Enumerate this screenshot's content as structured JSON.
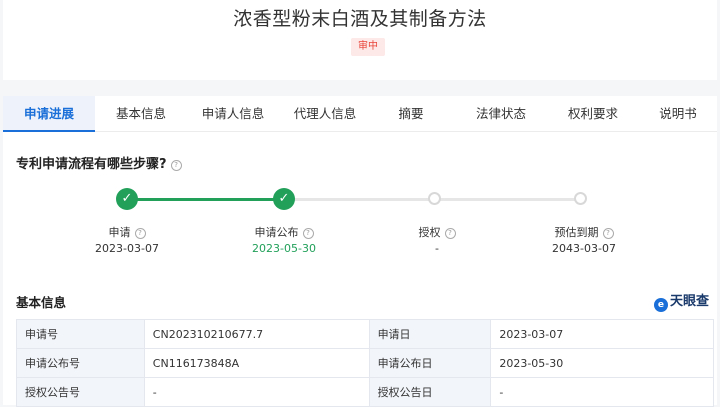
{
  "header": {
    "title": "浓香型粉末白酒及其制备方法",
    "status": "审中"
  },
  "tabs": [
    "申请进展",
    "基本信息",
    "申请人信息",
    "代理人信息",
    "摘要",
    "法律状态",
    "权利要求",
    "说明书"
  ],
  "progress": {
    "question": "专利申请流程有哪些步骤?",
    "steps": [
      {
        "label": "申请",
        "date": "2023-03-07"
      },
      {
        "label": "申请公布",
        "date": "2023-05-30"
      },
      {
        "label": "授权",
        "date": "-"
      },
      {
        "label": "预估到期",
        "date": "2043-03-07"
      }
    ]
  },
  "basic": {
    "title": "基本信息",
    "brand": "天眼查",
    "rows": [
      [
        "申请号",
        "CN202310210677.7",
        "申请日",
        "2023-03-07"
      ],
      [
        "申请公布号",
        "CN116173848A",
        "申请公布日",
        "2023-05-30"
      ],
      [
        "授权公告号",
        "-",
        "授权公告日",
        "-"
      ]
    ]
  }
}
